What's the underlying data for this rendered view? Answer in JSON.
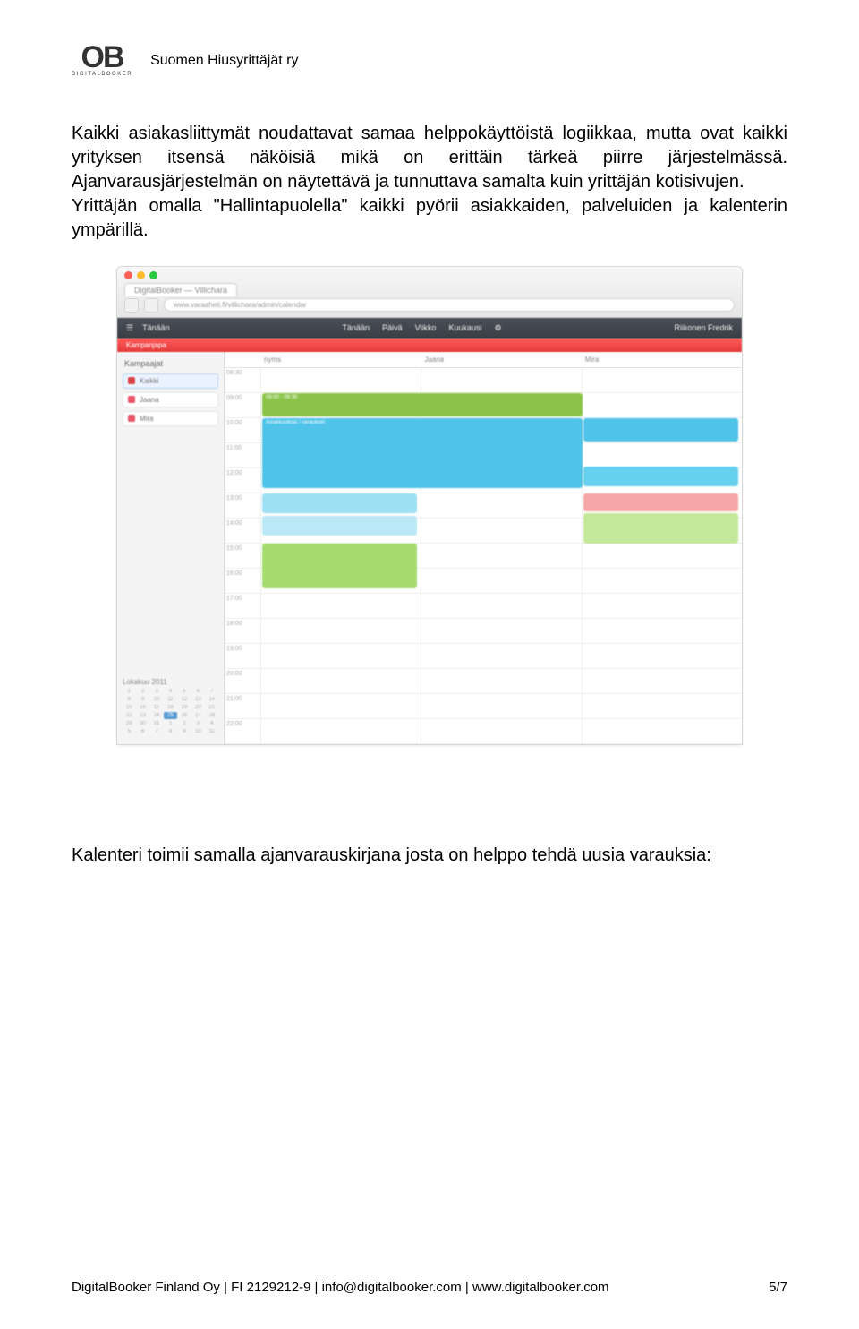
{
  "header": {
    "logo_main": "OB",
    "logo_sub": "DIGITALBOOKER",
    "org_name": "Suomen Hiusyrittäjät ry"
  },
  "body": {
    "para1": "Kaikki asiakasliittymät noudattavat samaa helppokäyttöistä logiikkaa, mutta ovat kaikki yrityksen itsensä näköisiä mikä on erittäin tärkeä piirre järjestelmässä. Ajanvarausjärjestelmän on näytettävä ja tunnuttava samalta kuin yrittäjän kotisivujen.",
    "para2": "Yrittäjän omalla \"Hallintapuolella\" kaikki pyörii asiakkaiden, palveluiden ja kalenterin ympärillä.",
    "para3": "Kalenteri toimii samalla ajanvarauskirjana josta on helppo tehdä uusia varauksia:"
  },
  "screenshot": {
    "tab_title": "DigitalBooker — Villichara",
    "url": "www.varaaheti.fi/villichara/admin/calendar",
    "appbar": {
      "menu_left": "Tänään",
      "menu_center": [
        "Tänään",
        "Päivä",
        "Viikko",
        "Kuukausi"
      ],
      "menu_right": "Riikonen Fredrik"
    },
    "promo": "Kampanjapa",
    "sidebar": {
      "title": "Kampaajat",
      "items": [
        "Kaikki",
        "Jaana",
        "Mira"
      ],
      "mini_cal_title": "Lokakuu 2011"
    },
    "columns": [
      "",
      "nyms",
      "Jaana",
      "Mira"
    ],
    "times": [
      "08:30",
      "09:00",
      "10:00",
      "11:00",
      "12:00",
      "13:00",
      "14:00",
      "15:00",
      "16:00",
      "17:00",
      "18:00",
      "19:00",
      "20:00",
      "21:00",
      "22:00"
    ]
  },
  "footer": {
    "left": "DigitalBooker Finland Oy | FI 2129212-9 | info@digitalbooker.com | www.digitalbooker.com",
    "right": "5/7"
  }
}
